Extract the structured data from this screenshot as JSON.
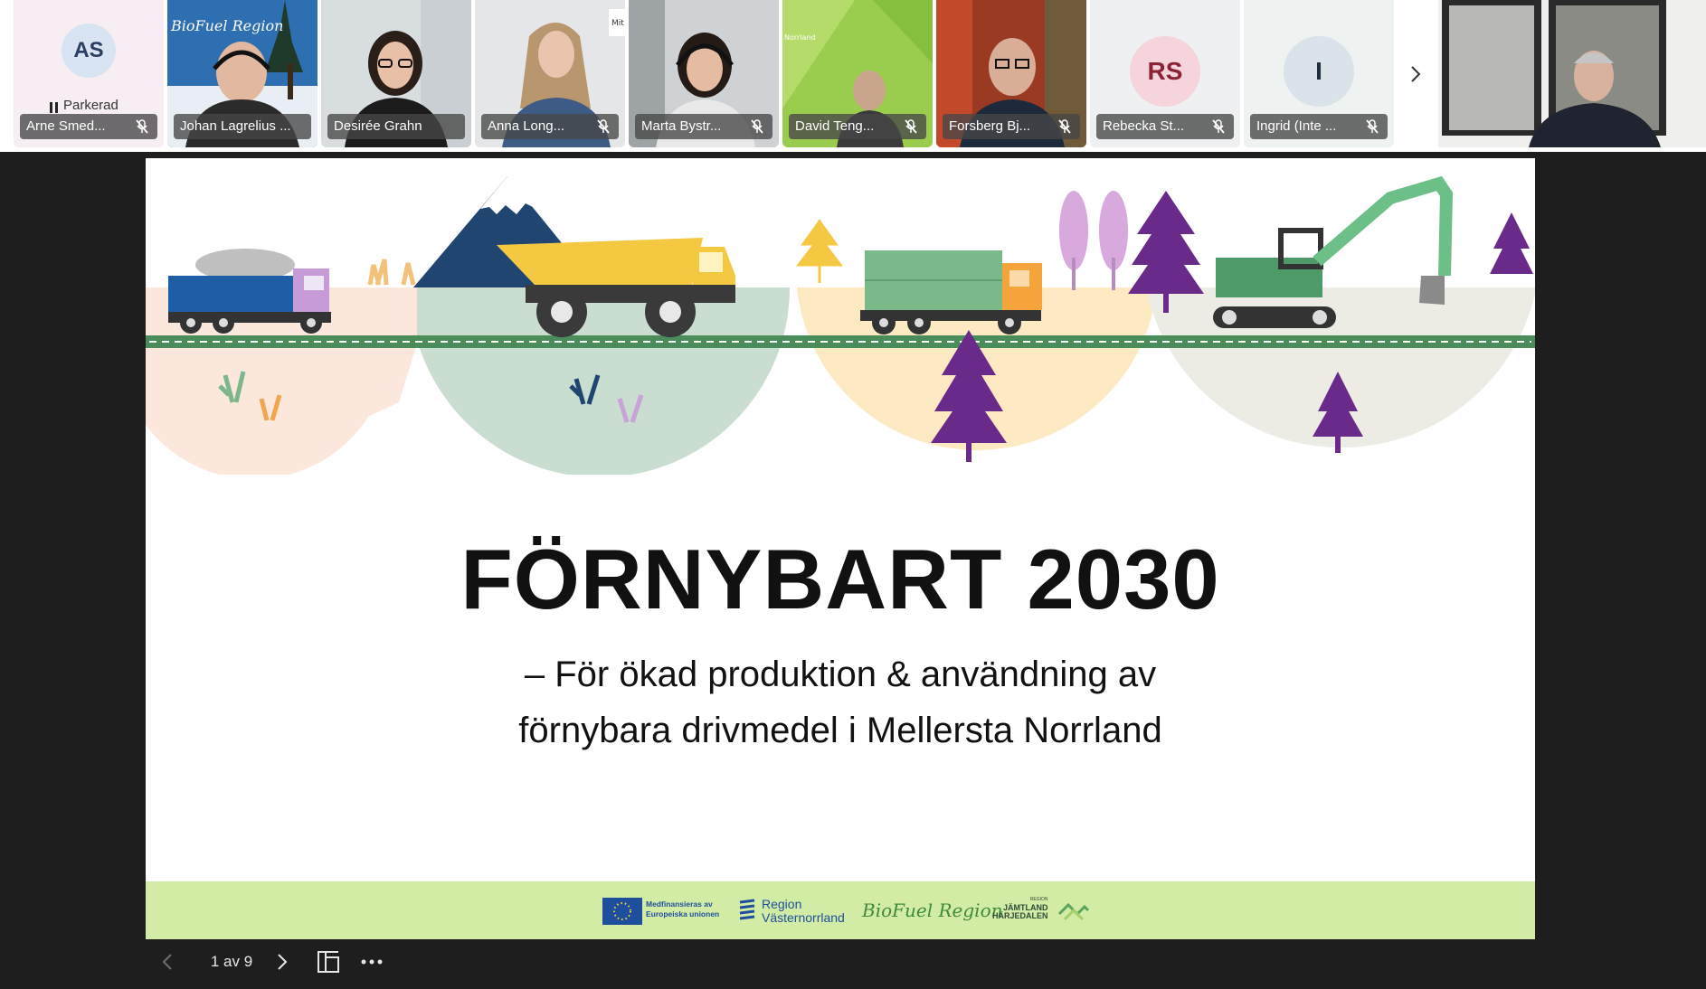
{
  "participants": [
    {
      "name": "Arne Smed...",
      "initials": "AS",
      "status": "Parkerad",
      "muted": true
    },
    {
      "name": "Johan Lagrelius ...",
      "muted": false
    },
    {
      "name": "Desirée Grahn",
      "muted": false
    },
    {
      "name": "Anna Long...",
      "muted": true
    },
    {
      "name": "Marta Bystr...",
      "muted": true
    },
    {
      "name": "David Teng...",
      "muted": true
    },
    {
      "name": "Forsberg Bj...",
      "muted": true
    },
    {
      "name": "Rebecka St...",
      "initials": "RS",
      "muted": true
    },
    {
      "name": "Ingrid (Inte ...",
      "initials": "I",
      "muted": true
    }
  ],
  "strip": {
    "next_icon": "chevron-right-icon"
  },
  "video_bg_texts": {
    "biofuel_sign": "BioFuel Region",
    "mit_text": "Mit",
    "norrland_text": "Norrland"
  },
  "slide": {
    "title": "FÖRNYBART 2030",
    "subtitle_line1": "– För ökad produktion & användning av",
    "subtitle_line2": "förnybara drivmedel i Mellersta Norrland",
    "footer": {
      "eu_line1": "Medfinansieras av",
      "eu_line2": "Europeiska unionen",
      "region_line1": "Region",
      "region_line2": "Västernorrland",
      "biofuel": "BioFuel Region",
      "jh_top": "REGION",
      "jh_line1": "JÄMTLAND",
      "jh_line2": "HÄRJEDALEN"
    }
  },
  "toolbar": {
    "page_indicator": "1 av 9",
    "prev_icon": "chevron-left-icon",
    "next_icon": "chevron-right-icon",
    "layout_icon": "layout-icon",
    "more_icon": "more-icon"
  },
  "colors": {
    "background": "#1e1e1e",
    "footer": "#d3eca5",
    "avatar_as": "#d9e4f2",
    "avatar_rs": "#f6d4dc",
    "avatar_i": "#dbe3ea"
  }
}
